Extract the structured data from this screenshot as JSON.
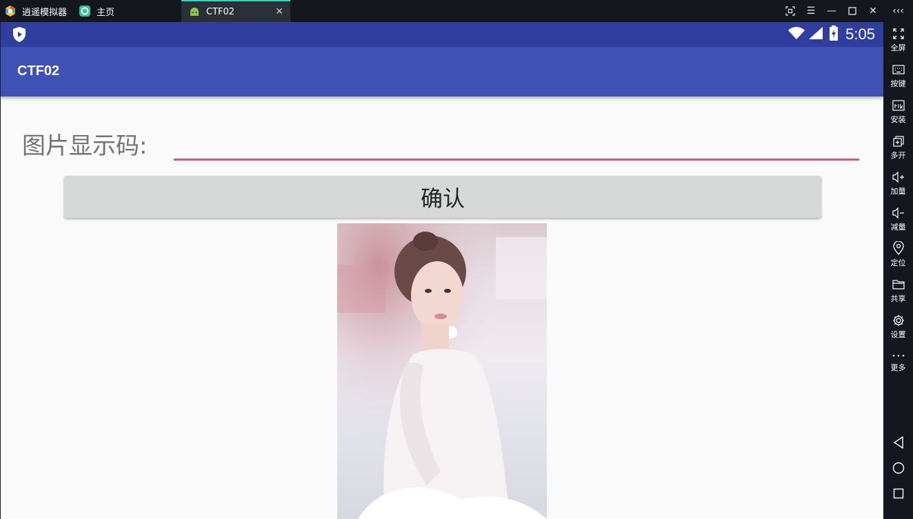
{
  "titlebar": {
    "emulator_tab": "逍遥模拟器",
    "home_tab": "主页",
    "active_tab": "CTF02",
    "window_controls": [
      "screenshot-icon",
      "menu-icon",
      "minimize-icon",
      "maximize-icon",
      "close-icon",
      "collapse-icon"
    ]
  },
  "statusbar": {
    "time": "5:05"
  },
  "appbar": {
    "title": "CTF02"
  },
  "form": {
    "label": "图片显示码:",
    "input_value": "",
    "confirm_label": "确认"
  },
  "sidebar": {
    "items": [
      {
        "label": "全屏",
        "icon": "fullscreen-icon"
      },
      {
        "label": "按键",
        "icon": "keyboard-icon"
      },
      {
        "label": "安装",
        "icon": "apk-install-icon"
      },
      {
        "label": "多开",
        "icon": "multi-instance-icon"
      },
      {
        "label": "加量",
        "icon": "volume-up-icon"
      },
      {
        "label": "减量",
        "icon": "volume-down-icon"
      },
      {
        "label": "定位",
        "icon": "location-icon"
      },
      {
        "label": "共享",
        "icon": "folder-icon"
      },
      {
        "label": "设置",
        "icon": "gear-icon"
      },
      {
        "label": "更多",
        "icon": "more-icon"
      }
    ],
    "nav": [
      "back-icon",
      "home-icon",
      "recents-icon"
    ]
  },
  "colors": {
    "statusbar": "#303f9f",
    "appbar": "#3f51b5",
    "input_underline": "#e84e86",
    "button_bg": "#d6d7d7",
    "emulator_chrome": "#14181e"
  }
}
